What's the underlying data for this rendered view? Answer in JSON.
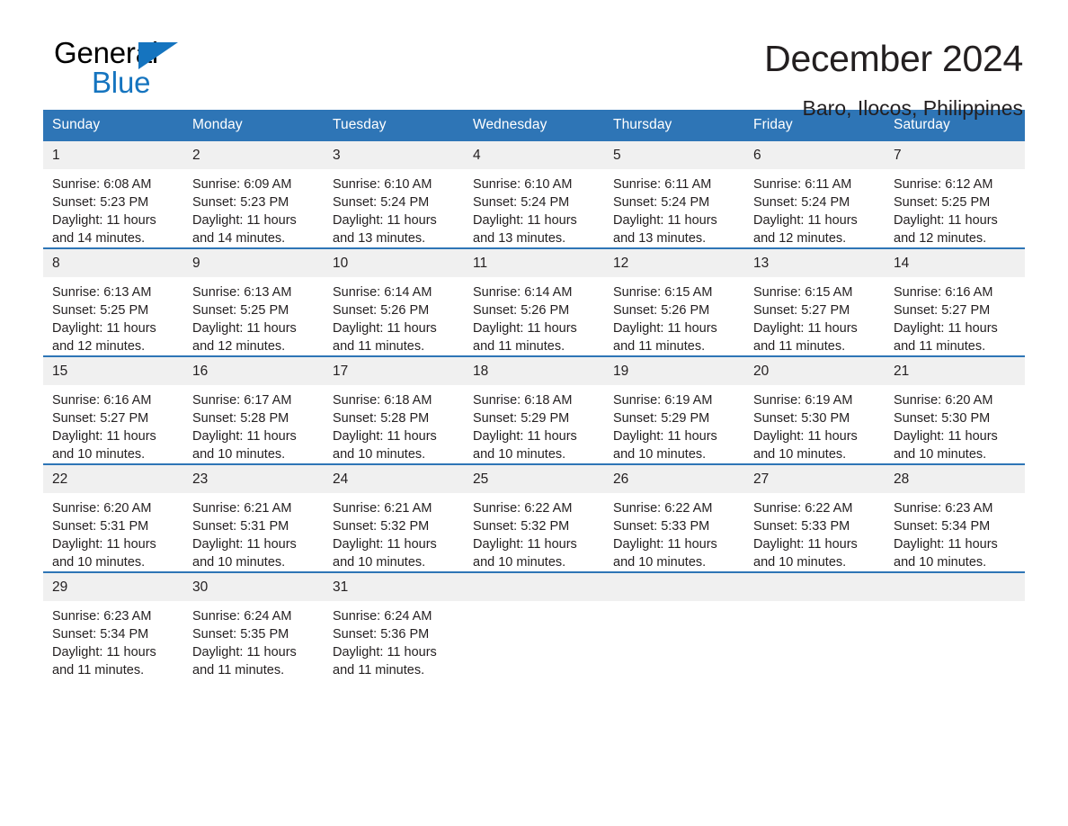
{
  "brand": {
    "name_part1": "General",
    "name_part2": "Blue",
    "triangle_color": "#1574bf"
  },
  "header": {
    "title": "December 2024",
    "subtitle": "Baro, Ilocos, Philippines"
  },
  "theme": {
    "header_blue": "#2e75b6",
    "day_band_gray": "#f0f0f0",
    "text": "#231f20"
  },
  "calendar": {
    "weekdays": [
      "Sunday",
      "Monday",
      "Tuesday",
      "Wednesday",
      "Thursday",
      "Friday",
      "Saturday"
    ],
    "weeks": [
      [
        {
          "day": "1",
          "sunrise": "Sunrise: 6:08 AM",
          "sunset": "Sunset: 5:23 PM",
          "daylight_line1": "Daylight: 11 hours",
          "daylight_line2": "and 14 minutes."
        },
        {
          "day": "2",
          "sunrise": "Sunrise: 6:09 AM",
          "sunset": "Sunset: 5:23 PM",
          "daylight_line1": "Daylight: 11 hours",
          "daylight_line2": "and 14 minutes."
        },
        {
          "day": "3",
          "sunrise": "Sunrise: 6:10 AM",
          "sunset": "Sunset: 5:24 PM",
          "daylight_line1": "Daylight: 11 hours",
          "daylight_line2": "and 13 minutes."
        },
        {
          "day": "4",
          "sunrise": "Sunrise: 6:10 AM",
          "sunset": "Sunset: 5:24 PM",
          "daylight_line1": "Daylight: 11 hours",
          "daylight_line2": "and 13 minutes."
        },
        {
          "day": "5",
          "sunrise": "Sunrise: 6:11 AM",
          "sunset": "Sunset: 5:24 PM",
          "daylight_line1": "Daylight: 11 hours",
          "daylight_line2": "and 13 minutes."
        },
        {
          "day": "6",
          "sunrise": "Sunrise: 6:11 AM",
          "sunset": "Sunset: 5:24 PM",
          "daylight_line1": "Daylight: 11 hours",
          "daylight_line2": "and 12 minutes."
        },
        {
          "day": "7",
          "sunrise": "Sunrise: 6:12 AM",
          "sunset": "Sunset: 5:25 PM",
          "daylight_line1": "Daylight: 11 hours",
          "daylight_line2": "and 12 minutes."
        }
      ],
      [
        {
          "day": "8",
          "sunrise": "Sunrise: 6:13 AM",
          "sunset": "Sunset: 5:25 PM",
          "daylight_line1": "Daylight: 11 hours",
          "daylight_line2": "and 12 minutes."
        },
        {
          "day": "9",
          "sunrise": "Sunrise: 6:13 AM",
          "sunset": "Sunset: 5:25 PM",
          "daylight_line1": "Daylight: 11 hours",
          "daylight_line2": "and 12 minutes."
        },
        {
          "day": "10",
          "sunrise": "Sunrise: 6:14 AM",
          "sunset": "Sunset: 5:26 PM",
          "daylight_line1": "Daylight: 11 hours",
          "daylight_line2": "and 11 minutes."
        },
        {
          "day": "11",
          "sunrise": "Sunrise: 6:14 AM",
          "sunset": "Sunset: 5:26 PM",
          "daylight_line1": "Daylight: 11 hours",
          "daylight_line2": "and 11 minutes."
        },
        {
          "day": "12",
          "sunrise": "Sunrise: 6:15 AM",
          "sunset": "Sunset: 5:26 PM",
          "daylight_line1": "Daylight: 11 hours",
          "daylight_line2": "and 11 minutes."
        },
        {
          "day": "13",
          "sunrise": "Sunrise: 6:15 AM",
          "sunset": "Sunset: 5:27 PM",
          "daylight_line1": "Daylight: 11 hours",
          "daylight_line2": "and 11 minutes."
        },
        {
          "day": "14",
          "sunrise": "Sunrise: 6:16 AM",
          "sunset": "Sunset: 5:27 PM",
          "daylight_line1": "Daylight: 11 hours",
          "daylight_line2": "and 11 minutes."
        }
      ],
      [
        {
          "day": "15",
          "sunrise": "Sunrise: 6:16 AM",
          "sunset": "Sunset: 5:27 PM",
          "daylight_line1": "Daylight: 11 hours",
          "daylight_line2": "and 10 minutes."
        },
        {
          "day": "16",
          "sunrise": "Sunrise: 6:17 AM",
          "sunset": "Sunset: 5:28 PM",
          "daylight_line1": "Daylight: 11 hours",
          "daylight_line2": "and 10 minutes."
        },
        {
          "day": "17",
          "sunrise": "Sunrise: 6:18 AM",
          "sunset": "Sunset: 5:28 PM",
          "daylight_line1": "Daylight: 11 hours",
          "daylight_line2": "and 10 minutes."
        },
        {
          "day": "18",
          "sunrise": "Sunrise: 6:18 AM",
          "sunset": "Sunset: 5:29 PM",
          "daylight_line1": "Daylight: 11 hours",
          "daylight_line2": "and 10 minutes."
        },
        {
          "day": "19",
          "sunrise": "Sunrise: 6:19 AM",
          "sunset": "Sunset: 5:29 PM",
          "daylight_line1": "Daylight: 11 hours",
          "daylight_line2": "and 10 minutes."
        },
        {
          "day": "20",
          "sunrise": "Sunrise: 6:19 AM",
          "sunset": "Sunset: 5:30 PM",
          "daylight_line1": "Daylight: 11 hours",
          "daylight_line2": "and 10 minutes."
        },
        {
          "day": "21",
          "sunrise": "Sunrise: 6:20 AM",
          "sunset": "Sunset: 5:30 PM",
          "daylight_line1": "Daylight: 11 hours",
          "daylight_line2": "and 10 minutes."
        }
      ],
      [
        {
          "day": "22",
          "sunrise": "Sunrise: 6:20 AM",
          "sunset": "Sunset: 5:31 PM",
          "daylight_line1": "Daylight: 11 hours",
          "daylight_line2": "and 10 minutes."
        },
        {
          "day": "23",
          "sunrise": "Sunrise: 6:21 AM",
          "sunset": "Sunset: 5:31 PM",
          "daylight_line1": "Daylight: 11 hours",
          "daylight_line2": "and 10 minutes."
        },
        {
          "day": "24",
          "sunrise": "Sunrise: 6:21 AM",
          "sunset": "Sunset: 5:32 PM",
          "daylight_line1": "Daylight: 11 hours",
          "daylight_line2": "and 10 minutes."
        },
        {
          "day": "25",
          "sunrise": "Sunrise: 6:22 AM",
          "sunset": "Sunset: 5:32 PM",
          "daylight_line1": "Daylight: 11 hours",
          "daylight_line2": "and 10 minutes."
        },
        {
          "day": "26",
          "sunrise": "Sunrise: 6:22 AM",
          "sunset": "Sunset: 5:33 PM",
          "daylight_line1": "Daylight: 11 hours",
          "daylight_line2": "and 10 minutes."
        },
        {
          "day": "27",
          "sunrise": "Sunrise: 6:22 AM",
          "sunset": "Sunset: 5:33 PM",
          "daylight_line1": "Daylight: 11 hours",
          "daylight_line2": "and 10 minutes."
        },
        {
          "day": "28",
          "sunrise": "Sunrise: 6:23 AM",
          "sunset": "Sunset: 5:34 PM",
          "daylight_line1": "Daylight: 11 hours",
          "daylight_line2": "and 10 minutes."
        }
      ],
      [
        {
          "day": "29",
          "sunrise": "Sunrise: 6:23 AM",
          "sunset": "Sunset: 5:34 PM",
          "daylight_line1": "Daylight: 11 hours",
          "daylight_line2": "and 11 minutes."
        },
        {
          "day": "30",
          "sunrise": "Sunrise: 6:24 AM",
          "sunset": "Sunset: 5:35 PM",
          "daylight_line1": "Daylight: 11 hours",
          "daylight_line2": "and 11 minutes."
        },
        {
          "day": "31",
          "sunrise": "Sunrise: 6:24 AM",
          "sunset": "Sunset: 5:36 PM",
          "daylight_line1": "Daylight: 11 hours",
          "daylight_line2": "and 11 minutes."
        },
        {
          "day": "",
          "sunrise": "",
          "sunset": "",
          "daylight_line1": "",
          "daylight_line2": ""
        },
        {
          "day": "",
          "sunrise": "",
          "sunset": "",
          "daylight_line1": "",
          "daylight_line2": ""
        },
        {
          "day": "",
          "sunrise": "",
          "sunset": "",
          "daylight_line1": "",
          "daylight_line2": ""
        },
        {
          "day": "",
          "sunrise": "",
          "sunset": "",
          "daylight_line1": "",
          "daylight_line2": ""
        }
      ]
    ]
  }
}
